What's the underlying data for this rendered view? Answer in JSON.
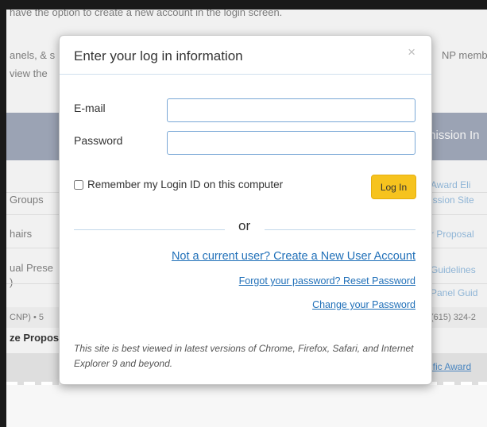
{
  "background": {
    "top_text": "have the option to create a new account in the login screen.",
    "left_texts": [
      "anels, & s",
      "view the",
      "Groups",
      "hairs",
      "ual Prese",
      ")",
      "CNP) • 5",
      "ze Propos"
    ],
    "right_texts": [
      "NP member",
      "mission In",
      "(615) 324-2"
    ],
    "right_links": [
      "Award Eli",
      "ission Site",
      "r Proposal",
      "Guidelines",
      "Panel Guid",
      "ific Award"
    ]
  },
  "modal": {
    "title": "Enter your log in information",
    "close_label": "×",
    "email_label": "E-mail",
    "email_value": "",
    "password_label": "Password",
    "password_value": "",
    "remember_label": "Remember my Login ID on this computer",
    "remember_checked": false,
    "login_button": "Log In",
    "or_text": "or",
    "create_account_link": "Not a current user? Create a New User Account",
    "forgot_password_link": "Forgot your password? Reset Password",
    "change_password_link": "Change your Password",
    "browser_note": "This site is best viewed in latest versions of Chrome, Firefox, Safari, and Internet Explorer 9 and beyond."
  },
  "colors": {
    "accent_button": "#f6c31e",
    "link": "#1f6fb8",
    "input_border": "#7aa8d6"
  }
}
